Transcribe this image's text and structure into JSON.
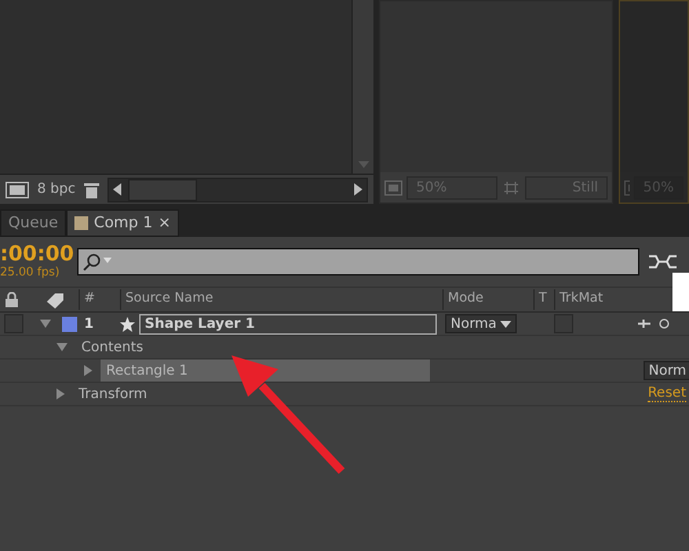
{
  "project_panel": {
    "bit_depth": "8 bpc"
  },
  "viewer_panel": {
    "zoom": "50%",
    "resolution": "Still"
  },
  "viewer_right": {
    "zoom": "50%",
    "selected": true
  },
  "tabs": [
    {
      "label": "Queue",
      "selected": false
    },
    {
      "label": "Comp 1",
      "selected": true,
      "color": "#b5a27f",
      "close": "×"
    }
  ],
  "timecode": ":00:00",
  "fps": "25.00 fps)",
  "columns": [
    "#",
    "Source Name",
    "Mode",
    "T",
    "TrkMat"
  ],
  "layers": [
    {
      "number": "1",
      "name": "Shape Layer 1",
      "mode": "Norma",
      "color": "#6a80e0",
      "expanded": true,
      "track_matte_checked": false,
      "children": [
        {
          "name": "Contents",
          "expanded": true,
          "children": [
            {
              "name": "Rectangle 1",
              "expanded": false,
              "selected": true,
              "mode": "Norm"
            }
          ]
        },
        {
          "name": "Transform",
          "expanded": false,
          "action": "Reset"
        }
      ]
    }
  ]
}
